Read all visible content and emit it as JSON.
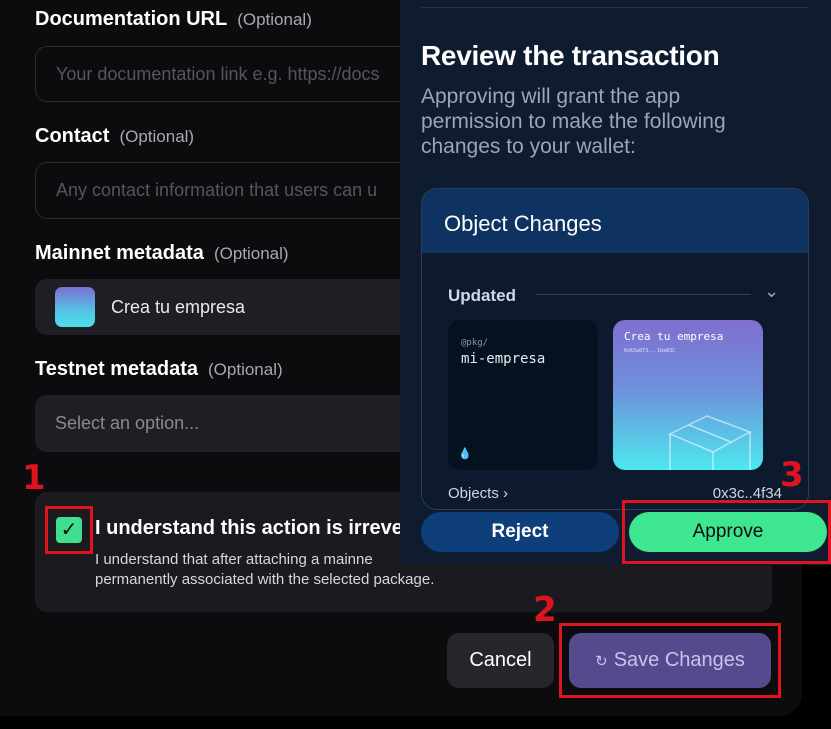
{
  "form": {
    "doc_url": {
      "label": "Documentation URL",
      "optional": "(Optional)",
      "placeholder": "Your documentation link e.g. https://docs"
    },
    "contact": {
      "label": "Contact",
      "optional": "(Optional)",
      "placeholder": "Any contact information that users can u"
    },
    "mainnet": {
      "label": "Mainnet metadata",
      "optional": "(Optional)",
      "value": "Crea tu empresa"
    },
    "testnet": {
      "label": "Testnet metadata",
      "optional": "(Optional)",
      "placeholder": "Select an option..."
    },
    "ack": {
      "title": "I understand this action is irreve",
      "desc_line1": "I understand that after attaching a mainne",
      "desc_line2": "permanently associated with the selected package."
    },
    "cancel_label": "Cancel",
    "save_label": "Save Changes"
  },
  "wallet": {
    "title": "Review the transaction",
    "description": "Approving will grant the app permission to make the following changes to your wallet:",
    "object_changes_title": "Object Changes",
    "updated_label": "Updated",
    "pkg_prefix": "@pkg/",
    "pkg_name": "mi-empresa",
    "meta_name": "Crea tu empresa",
    "meta_id": "0x63a073...1ba83C",
    "objects_row_left": "Objects ›",
    "objects_row_right": "0x3c..4f34",
    "reject_label": "Reject",
    "approve_label": "Approve"
  },
  "annotations": {
    "n1": "1",
    "n2": "2",
    "n3": "3"
  },
  "colors": {
    "accent_green": "#3ee68f",
    "highlight_red": "#e0141e",
    "save_purple": "#564a8e",
    "reject_blue": "#0f3f7b"
  }
}
